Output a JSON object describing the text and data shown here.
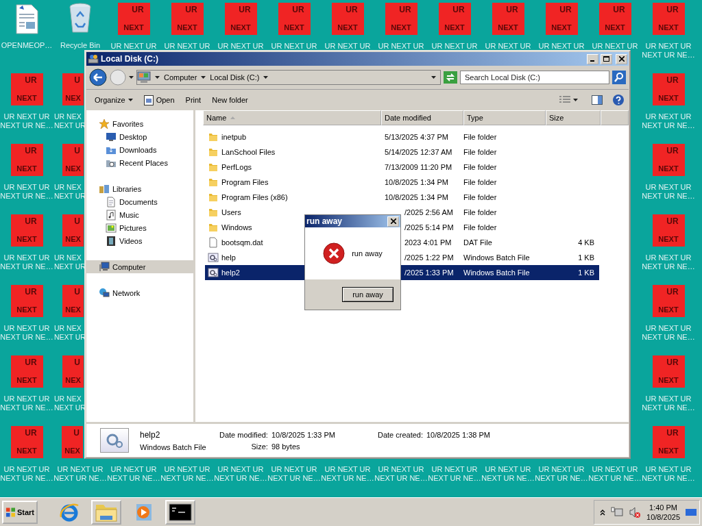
{
  "desktop": {
    "rows": [
      {
        "icons": [
          {
            "kind": "document",
            "lines": [
              "OPENMEOP…"
            ]
          },
          {
            "kind": "recycle",
            "lines": [
              "Recycle Bin"
            ]
          },
          {
            "kind": "red",
            "top": "UR",
            "bottom": "NEXT",
            "lines": [
              "UR NEXT UR"
            ]
          },
          {
            "kind": "red",
            "top": "UR",
            "bottom": "NEXT",
            "lines": [
              "UR NEXT UR"
            ]
          },
          {
            "kind": "red",
            "top": "UR",
            "bottom": "NEXT",
            "lines": [
              "UR NEXT UR"
            ]
          },
          {
            "kind": "red",
            "top": "UR",
            "bottom": "NEXT",
            "lines": [
              "UR NEXT UR"
            ]
          },
          {
            "kind": "red",
            "top": "UR",
            "bottom": "NEXT",
            "lines": [
              "UR NEXT UR"
            ]
          },
          {
            "kind": "red",
            "top": "UR",
            "bottom": "NEXT",
            "lines": [
              "UR NEXT UR"
            ]
          },
          {
            "kind": "red",
            "top": "UR",
            "bottom": "NEXT",
            "lines": [
              "UR NEXT UR"
            ]
          },
          {
            "kind": "red",
            "top": "UR",
            "bottom": "NEXT",
            "lines": [
              "UR NEXT UR"
            ]
          },
          {
            "kind": "red",
            "top": "UR",
            "bottom": "NEXT",
            "lines": [
              "UR NEXT UR"
            ]
          },
          {
            "kind": "red",
            "top": "UR",
            "bottom": "NEXT",
            "lines": [
              "UR NEXT UR"
            ]
          },
          {
            "kind": "red",
            "top": "UR",
            "bottom": "NEXT",
            "lines": [
              "UR NEXT UR",
              "NEXT UR NE…"
            ]
          }
        ]
      },
      {
        "icons": [
          {
            "kind": "red",
            "top": "UR",
            "bottom": "NEXT",
            "lines": [
              "UR NEXT UR",
              "NEXT UR NE…"
            ]
          },
          {
            "kind": "clipped",
            "top": "U",
            "bottom": "NEX",
            "lines": [
              "UR NEX",
              "NEXT UR"
            ]
          },
          {
            "kind": "red",
            "top": "UR",
            "bottom": "NEXT",
            "lines": [
              "UR NEXT UR",
              "NEXT UR NE…"
            ]
          }
        ]
      },
      {
        "icons": [
          {
            "kind": "red",
            "top": "UR",
            "bottom": "NEXT",
            "lines": [
              "UR NEXT UR",
              "NEXT UR NE…"
            ]
          },
          {
            "kind": "clipped",
            "top": "U",
            "bottom": "NEX",
            "lines": [
              "UR NEX",
              "NEXT UR"
            ]
          },
          {
            "kind": "red",
            "top": "UR",
            "bottom": "NEXT",
            "lines": [
              "UR NEXT UR",
              "NEXT UR NE…"
            ]
          }
        ]
      },
      {
        "icons": [
          {
            "kind": "red",
            "top": "UR",
            "bottom": "NEXT",
            "lines": [
              "UR NEXT UR",
              "NEXT UR NE…"
            ]
          },
          {
            "kind": "clipped",
            "top": "U",
            "bottom": "NEX",
            "lines": [
              "UR NEX",
              "NEXT UR"
            ]
          },
          {
            "kind": "red",
            "top": "UR",
            "bottom": "NEXT",
            "lines": [
              "UR NEXT UR",
              "NEXT UR NE…"
            ]
          }
        ]
      },
      {
        "icons": [
          {
            "kind": "red",
            "top": "UR",
            "bottom": "NEXT",
            "lines": [
              "UR NEXT UR",
              "NEXT UR NE…"
            ]
          },
          {
            "kind": "clipped",
            "top": "U",
            "bottom": "NEX",
            "lines": [
              "UR NEX",
              "NEXT UR"
            ]
          },
          {
            "kind": "red",
            "top": "UR",
            "bottom": "NEXT",
            "lines": [
              "UR NEXT UR",
              "NEXT UR NE…"
            ]
          }
        ]
      },
      {
        "icons": [
          {
            "kind": "red",
            "top": "UR",
            "bottom": "NEXT",
            "lines": [
              "UR NEXT UR",
              "NEXT UR NE…"
            ]
          },
          {
            "kind": "clipped",
            "top": "U",
            "bottom": "NEX",
            "lines": [
              "UR NEX",
              "NEXT UR"
            ]
          },
          {
            "kind": "red",
            "top": "UR",
            "bottom": "NEXT",
            "lines": [
              "UR NEXT UR",
              "NEXT UR NE…"
            ]
          }
        ]
      },
      {
        "icons": [
          {
            "kind": "red",
            "top": "UR",
            "bottom": "NEXT",
            "lines": [
              "UR NEXT UR",
              "NEXT UR NE…"
            ]
          },
          {
            "kind": "cut",
            "top": "U",
            "bottom": "NEX",
            "lines": [
              "UR NEXT UR",
              "NEXT UR NE…"
            ]
          },
          {
            "kind": "label",
            "lines": [
              "UR NEXT UR",
              "NEXT UR NE…"
            ]
          },
          {
            "kind": "label",
            "lines": [
              "UR NEXT UR",
              "NEXT UR NE…"
            ]
          },
          {
            "kind": "label",
            "lines": [
              "UR NEXT UR",
              "NEXT UR NE…"
            ]
          },
          {
            "kind": "label",
            "lines": [
              "UR NEXT UR",
              "NEXT UR NE…"
            ]
          },
          {
            "kind": "label",
            "lines": [
              "UR NEXT UR",
              "NEXT UR NE…"
            ]
          },
          {
            "kind": "label",
            "lines": [
              "UR NEXT UR",
              "NEXT UR NE…"
            ]
          },
          {
            "kind": "label",
            "lines": [
              "UR NEXT UR",
              "NEXT UR NE…"
            ]
          },
          {
            "kind": "label",
            "lines": [
              "UR NEXT UR",
              "NEXT UR NE…"
            ]
          },
          {
            "kind": "label",
            "lines": [
              "UR NEXT UR",
              "NEXT UR NE…"
            ]
          },
          {
            "kind": "label",
            "lines": [
              "UR NEXT UR",
              "NEXT UR NE…"
            ]
          },
          {
            "kind": "red",
            "top": "UR",
            "bottom": "NEXT",
            "lines": [
              "UR NEXT UR",
              "NEXT UR NE…"
            ]
          }
        ]
      }
    ]
  },
  "explorer": {
    "title": "Local Disk (C:)",
    "breadcrumb": [
      "Computer",
      "Local Disk (C:)"
    ],
    "search": {
      "placeholder": "Search Local Disk (C:)"
    },
    "commands": [
      {
        "label": "Organize",
        "kind": "menu"
      },
      {
        "label": "Open",
        "kind": "icon"
      },
      {
        "label": "Print",
        "kind": "plain"
      },
      {
        "label": "New folder",
        "kind": "plain"
      }
    ],
    "nav": [
      {
        "label": "Favorites",
        "kind": "star",
        "selected": false,
        "children": [
          {
            "label": "Desktop",
            "kind": "desktop",
            "selected": false
          },
          {
            "label": "Downloads",
            "kind": "downloads",
            "selected": false
          },
          {
            "label": "Recent Places",
            "kind": "recent",
            "selected": false
          }
        ]
      },
      {
        "label": "Libraries",
        "kind": "library",
        "selected": false,
        "children": [
          {
            "label": "Documents",
            "kind": "documents",
            "selected": false
          },
          {
            "label": "Music",
            "kind": "music",
            "selected": false
          },
          {
            "label": "Pictures",
            "kind": "pictures",
            "selected": false
          },
          {
            "label": "Videos",
            "kind": "videos",
            "selected": false
          }
        ]
      },
      {
        "label": "Computer",
        "kind": "computer",
        "selected": true
      },
      {
        "label": "Network",
        "kind": "network",
        "selected": false
      }
    ],
    "columns": [
      {
        "label": "Name",
        "sorted": true
      },
      {
        "label": "Date modified",
        "sorted": false
      },
      {
        "label": "Type",
        "sorted": false
      },
      {
        "label": "Size",
        "sorted": false
      }
    ],
    "files": [
      {
        "name": "inetpub",
        "date": "5/13/2025 4:37 PM",
        "type": "File folder",
        "kind": "folder",
        "selected": false,
        "partly_hidden": false
      },
      {
        "name": "LanSchool Files",
        "date": "5/14/2025 12:37 AM",
        "type": "File folder",
        "kind": "folder",
        "selected": false,
        "partly_hidden": false
      },
      {
        "name": "PerfLogs",
        "date": "7/13/2009 11:20 PM",
        "type": "File folder",
        "kind": "folder",
        "selected": false,
        "partly_hidden": false
      },
      {
        "name": "Program Files",
        "date": "10/8/2025 1:34 PM",
        "type": "File folder",
        "kind": "folder",
        "selected": false,
        "partly_hidden": false
      },
      {
        "name": "Program Files (x86)",
        "date": "10/8/2025 1:34 PM",
        "type": "File folder",
        "kind": "folder",
        "selected": false,
        "partly_hidden": false
      },
      {
        "name": "Users",
        "date": "/2025 2:56 AM",
        "type": "File folder",
        "kind": "folder",
        "selected": false,
        "partly_hidden": true
      },
      {
        "name": "Windows",
        "date": "/2025 5:14 PM",
        "type": "File folder",
        "kind": "folder",
        "selected": false,
        "partly_hidden": true
      },
      {
        "name": "bootsqm.dat",
        "date": "2023 4:01 PM",
        "type": "DAT File",
        "size": "4 KB",
        "kind": "file",
        "selected": false,
        "partly_hidden": true
      },
      {
        "name": "help",
        "date": "/2025 1:22 PM",
        "type": "Windows Batch File",
        "size": "1 KB",
        "kind": "batch",
        "selected": false,
        "partly_hidden": true
      },
      {
        "name": "help2",
        "date": "/2025 1:33 PM",
        "type": "Windows Batch File",
        "size": "1 KB",
        "kind": "batch",
        "selected": true,
        "partly_hidden": true
      }
    ],
    "details": {
      "name": "help2",
      "type": "Windows Batch File",
      "fields": [
        {
          "label": "Date modified:",
          "value": "10/8/2025 1:33 PM"
        },
        {
          "label": "Date created:",
          "value": "10/8/2025 1:38 PM"
        },
        {
          "label": "Size:",
          "value": "98 bytes"
        }
      ]
    }
  },
  "dialog": {
    "title": "run away",
    "message": "run away",
    "button": "run away"
  },
  "taskbar": {
    "start": "Start",
    "apps": [
      {
        "kind": "browser",
        "open": false
      },
      {
        "kind": "folders",
        "open": true
      },
      {
        "kind": "media",
        "open": false
      },
      {
        "kind": "console",
        "open": true
      }
    ],
    "clock": {
      "time": "1:40 PM",
      "date": "10/8/2025"
    }
  }
}
